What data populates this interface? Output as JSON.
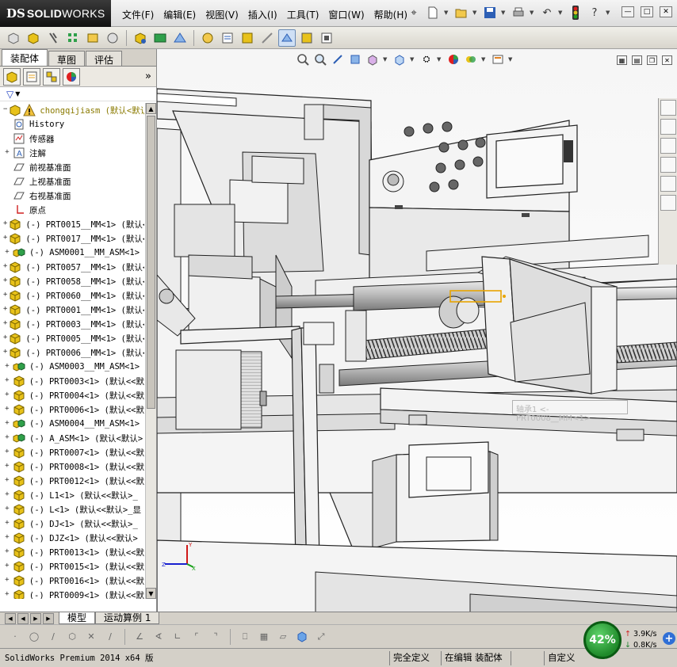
{
  "app": {
    "logo_ds": "DS",
    "logo_solid": "SOLID",
    "logo_works": "WORKS"
  },
  "menu": [
    {
      "label": "文件(F)"
    },
    {
      "label": "编辑(E)"
    },
    {
      "label": "视图(V)"
    },
    {
      "label": "插入(I)"
    },
    {
      "label": "工具(T)"
    },
    {
      "label": "窗口(W)"
    },
    {
      "label": "帮助(H)"
    }
  ],
  "panel_tabs": [
    {
      "label": "装配体",
      "active": true
    },
    {
      "label": "草图",
      "active": false
    },
    {
      "label": "评估",
      "active": false
    }
  ],
  "tree": {
    "root": "chongqijiasm  (默认<默认>_",
    "items": [
      {
        "label": "History",
        "icon": "history-icon",
        "expander": ""
      },
      {
        "label": "传感器",
        "icon": "sensor-icon",
        "expander": ""
      },
      {
        "label": "注解",
        "icon": "annotation-icon",
        "expander": "+"
      },
      {
        "label": "前视基准面",
        "icon": "plane-icon",
        "expander": ""
      },
      {
        "label": "上视基准面",
        "icon": "plane-icon",
        "expander": ""
      },
      {
        "label": "右视基准面",
        "icon": "plane-icon",
        "expander": ""
      },
      {
        "label": "原点",
        "icon": "origin-icon",
        "expander": ""
      },
      {
        "label": "(-) PRT0015__MM<1> (默认<",
        "icon": "part-icon",
        "expander": "+"
      },
      {
        "label": "(-) PRT0017__MM<1> (默认<",
        "icon": "part-icon",
        "expander": "+"
      },
      {
        "label": "(-) ASM0001__MM_ASM<1>",
        "icon": "assembly-icon",
        "expander": "+"
      },
      {
        "label": "(-) PRT0057__MM<1> (默认<",
        "icon": "part-icon",
        "expander": "+"
      },
      {
        "label": "(-) PRT0058__MM<1> (默认<",
        "icon": "part-icon",
        "expander": "+"
      },
      {
        "label": "(-) PRT0060__MM<1> (默认<",
        "icon": "part-icon",
        "expander": "+"
      },
      {
        "label": "(-) PRT0001__MM<1> (默认<",
        "icon": "part-icon",
        "expander": "+"
      },
      {
        "label": "(-) PRT0003__MM<1> (默认<",
        "icon": "part-icon",
        "expander": "+"
      },
      {
        "label": "(-) PRT0005__MM<1> (默认<",
        "icon": "part-icon",
        "expander": "+"
      },
      {
        "label": "(-) PRT0006__MM<1> (默认<",
        "icon": "part-icon",
        "expander": "+"
      },
      {
        "label": "(-) ASM0003__MM_ASM<1>",
        "icon": "assembly-icon",
        "expander": "+"
      },
      {
        "label": "(-) PRT0003<1> (默认<<默",
        "icon": "part-icon",
        "expander": "+"
      },
      {
        "label": "(-) PRT0004<1> (默认<<默",
        "icon": "part-icon",
        "expander": "+"
      },
      {
        "label": "(-) PRT0006<1> (默认<<默",
        "icon": "part-icon",
        "expander": "+"
      },
      {
        "label": "(-) ASM0004__MM_ASM<1>",
        "icon": "assembly-icon",
        "expander": "+"
      },
      {
        "label": "(-) A_ASM<1> (默认<默认>",
        "icon": "assembly-icon",
        "expander": "+"
      },
      {
        "label": "(-) PRT0007<1> (默认<<默",
        "icon": "part-icon",
        "expander": "+"
      },
      {
        "label": "(-) PRT0008<1> (默认<<默",
        "icon": "part-icon",
        "expander": "+"
      },
      {
        "label": "(-) PRT0012<1> (默认<<默",
        "icon": "part-icon",
        "expander": "+"
      },
      {
        "label": "(-) L1<1> (默认<<默认>_",
        "icon": "part-icon",
        "expander": "+"
      },
      {
        "label": "(-) L<1> (默认<<默认>_显",
        "icon": "part-icon",
        "expander": "+"
      },
      {
        "label": "(-) DJ<1> (默认<<默认>_",
        "icon": "part-icon",
        "expander": "+"
      },
      {
        "label": "(-) DJZ<1> (默认<<默认>",
        "icon": "part-icon",
        "expander": "+"
      },
      {
        "label": "(-) PRT0013<1> (默认<<默",
        "icon": "part-icon",
        "expander": "+"
      },
      {
        "label": "(-) PRT0015<1> (默认<<默",
        "icon": "part-icon",
        "expander": "+"
      },
      {
        "label": "(-) PRT0016<1> (默认<<默",
        "icon": "part-icon",
        "expander": "+"
      },
      {
        "label": "(-) PRT0009<1> (默认<<默",
        "icon": "part-icon",
        "expander": "+"
      }
    ]
  },
  "viewport": {
    "callout_text": "轴承1 <- PRT0008__MM<1>"
  },
  "bottom_tabs": [
    {
      "label": "模型",
      "active": true
    },
    {
      "label": "运动算例 1",
      "active": false
    }
  ],
  "status": {
    "version": "SolidWorks Premium 2014 x64 版",
    "state": "完全定义",
    "editing": "在编辑 装配体",
    "custom": "自定义"
  },
  "net": {
    "cpu": "42%",
    "up": "3.9K/s",
    "down": "0.8K/s"
  },
  "colors": {
    "accent_blue": "#2f6fd6",
    "part_yellow": "#e8c21a",
    "cpu_green": "#1f8a2a"
  }
}
